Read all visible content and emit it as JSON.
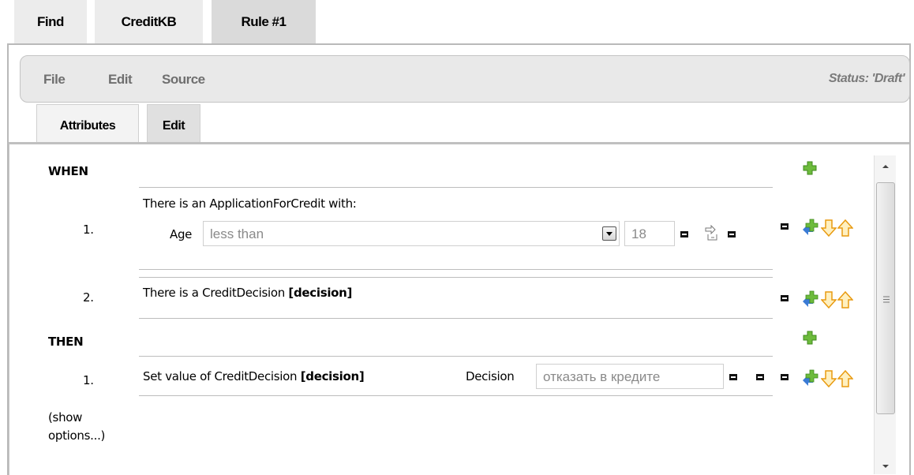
{
  "tabs": [
    {
      "label": "Find"
    },
    {
      "label": "CreditKB"
    },
    {
      "label": "Rule #1"
    }
  ],
  "menu": {
    "file": "File",
    "edit": "Edit",
    "source": "Source",
    "status": "Status: 'Draft'"
  },
  "subtabs": [
    {
      "label": "Attributes"
    },
    {
      "label": "Edit"
    }
  ],
  "rule": {
    "when_label": "WHEN",
    "then_label": "THEN",
    "conditions": [
      {
        "number": "1.",
        "text": "There is an ApplicationForCredit with:",
        "field_label": "Age",
        "operator": "less than",
        "value": "18"
      },
      {
        "number": "2.",
        "text": "There is a CreditDecision ",
        "binding": "[decision]"
      }
    ],
    "actions": [
      {
        "number": "1.",
        "text": "Set value of CreditDecision ",
        "binding": "[decision]",
        "field_label": "Decision",
        "value": "отказать в кредите"
      }
    ],
    "show_options_line1": "(show",
    "show_options_line2": "options...)"
  },
  "colors": {
    "plus_green": "#6dbb3c",
    "arrow_orange": "#f0a020",
    "arrow_blue": "#3a7bd5"
  },
  "icons": [
    "plus-icon",
    "insert-plus-icon",
    "move-down-icon",
    "move-up-icon",
    "remove-icon",
    "condition-link-icon",
    "dropdown-icon"
  ]
}
